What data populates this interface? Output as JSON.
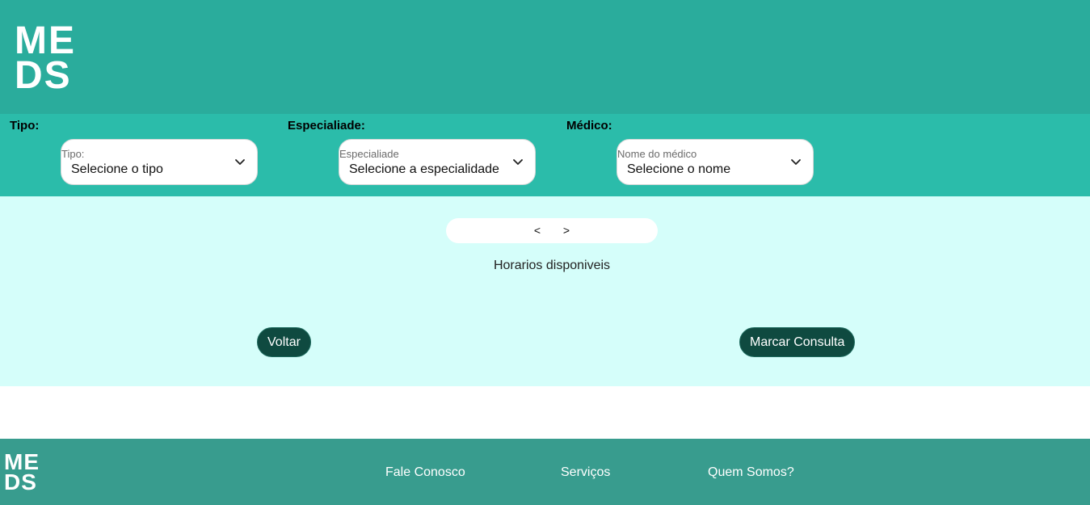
{
  "header": {
    "logo_line1": "ME",
    "logo_line2": "DS"
  },
  "filters": {
    "tipo": {
      "label": "Tipo:",
      "caption": "Tipo:",
      "value": "Selecione o tipo",
      "icon": "chevron-down-icon"
    },
    "especialidade": {
      "label": "Especialiade:",
      "caption": "Especialiade",
      "value": "Selecione a especialidade",
      "icon": "chevron-down-icon"
    },
    "medico": {
      "label": "Médico:",
      "caption": "Nome do médico",
      "value": "Selecione o nome",
      "icon": "chevron-down-icon"
    }
  },
  "schedule": {
    "prev": "<",
    "next": ">",
    "available_title": "Horarios disponiveis"
  },
  "actions": {
    "back_label": "Voltar",
    "book_label": "Marcar Consulta"
  },
  "footer": {
    "logo_line1": "ME",
    "logo_line2": "DS",
    "links": [
      "Fale Conosco",
      "Serviços",
      "Quem Somos?"
    ]
  },
  "colors": {
    "header": "#2aac9c",
    "filters_bar": "#2bbcaa",
    "main_bg": "#d5fefa",
    "button": "#0f4a40",
    "footer": "#389c8e"
  }
}
